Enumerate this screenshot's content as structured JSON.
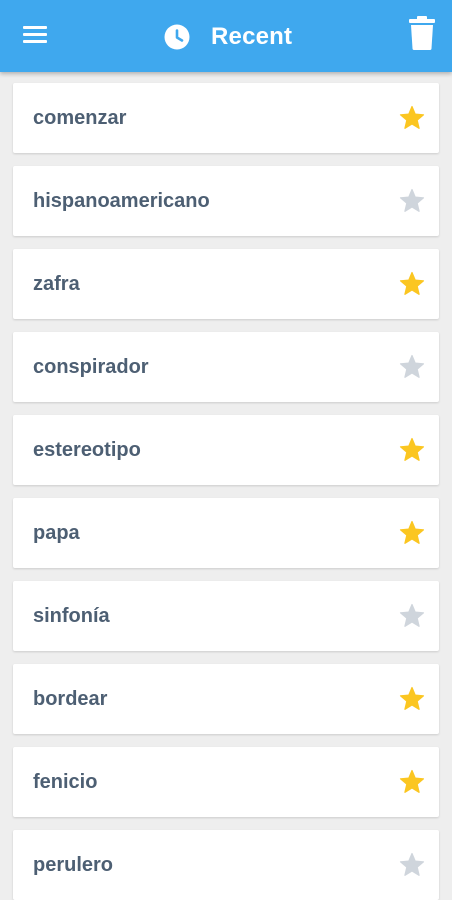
{
  "header": {
    "title": "Recent",
    "menu_icon": "hamburger-menu-icon",
    "title_icon": "clock-icon",
    "action_icon": "trash-icon",
    "background_color": "#3fa8ee"
  },
  "colors": {
    "star_active": "#fbc621",
    "star_inactive": "#cfd5dc",
    "word_text": "#4d5f73"
  },
  "recent_words": [
    {
      "word": "comenzar",
      "starred": true
    },
    {
      "word": "hispanoamericano",
      "starred": false
    },
    {
      "word": "zafra",
      "starred": true
    },
    {
      "word": "conspirador",
      "starred": false
    },
    {
      "word": "estereotipo",
      "starred": true
    },
    {
      "word": "papa",
      "starred": true
    },
    {
      "word": "sinfonía",
      "starred": false
    },
    {
      "word": "bordear",
      "starred": true
    },
    {
      "word": "fenicio",
      "starred": true
    },
    {
      "word": "perulero",
      "starred": false
    }
  ]
}
